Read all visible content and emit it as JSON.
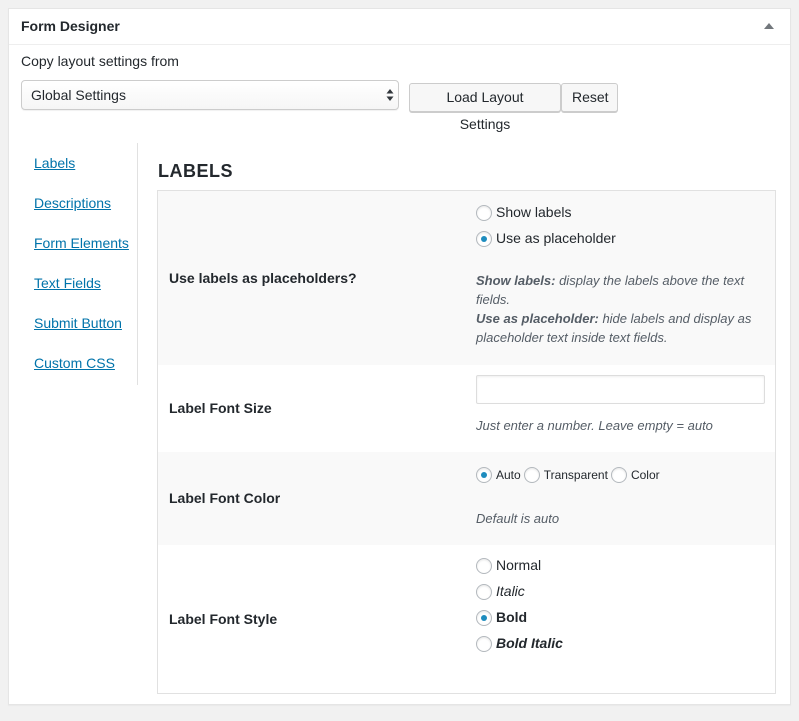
{
  "panel": {
    "title": "Form Designer",
    "copy_label": "Copy layout settings from",
    "select_value": "Global Settings",
    "load_button": "Load Layout Settings",
    "reset_button": "Reset"
  },
  "nav": {
    "items": [
      "Labels",
      "Descriptions",
      "Form Elements",
      "Text Fields",
      "Submit Button",
      "Custom CSS"
    ]
  },
  "section": {
    "title": "LABELS"
  },
  "settings": {
    "placeholders": {
      "label": "Use labels as placeholders?",
      "options": [
        "Show labels",
        "Use as placeholder"
      ],
      "selected": "Use as placeholder",
      "help_show_bold": "Show labels:",
      "help_show": " display the labels above the text fields.",
      "help_placeholder_bold": "Use as placeholder:",
      "help_placeholder": " hide labels and display as placeholder text inside text fields."
    },
    "font_size": {
      "label": "Label Font Size",
      "value": "",
      "help": "Just enter a number. Leave empty = auto"
    },
    "font_color": {
      "label": "Label Font Color",
      "options": [
        "Auto",
        "Transparent",
        "Color"
      ],
      "selected": "Auto",
      "help": "Default is auto"
    },
    "font_style": {
      "label": "Label Font Style",
      "options": [
        "Normal",
        "Italic",
        "Bold",
        "Bold Italic"
      ],
      "selected": "Bold"
    }
  },
  "colors": {
    "link": "#0073aa",
    "radio_checked": "#1e8cbe",
    "row_shade": "#f9f9f9"
  }
}
